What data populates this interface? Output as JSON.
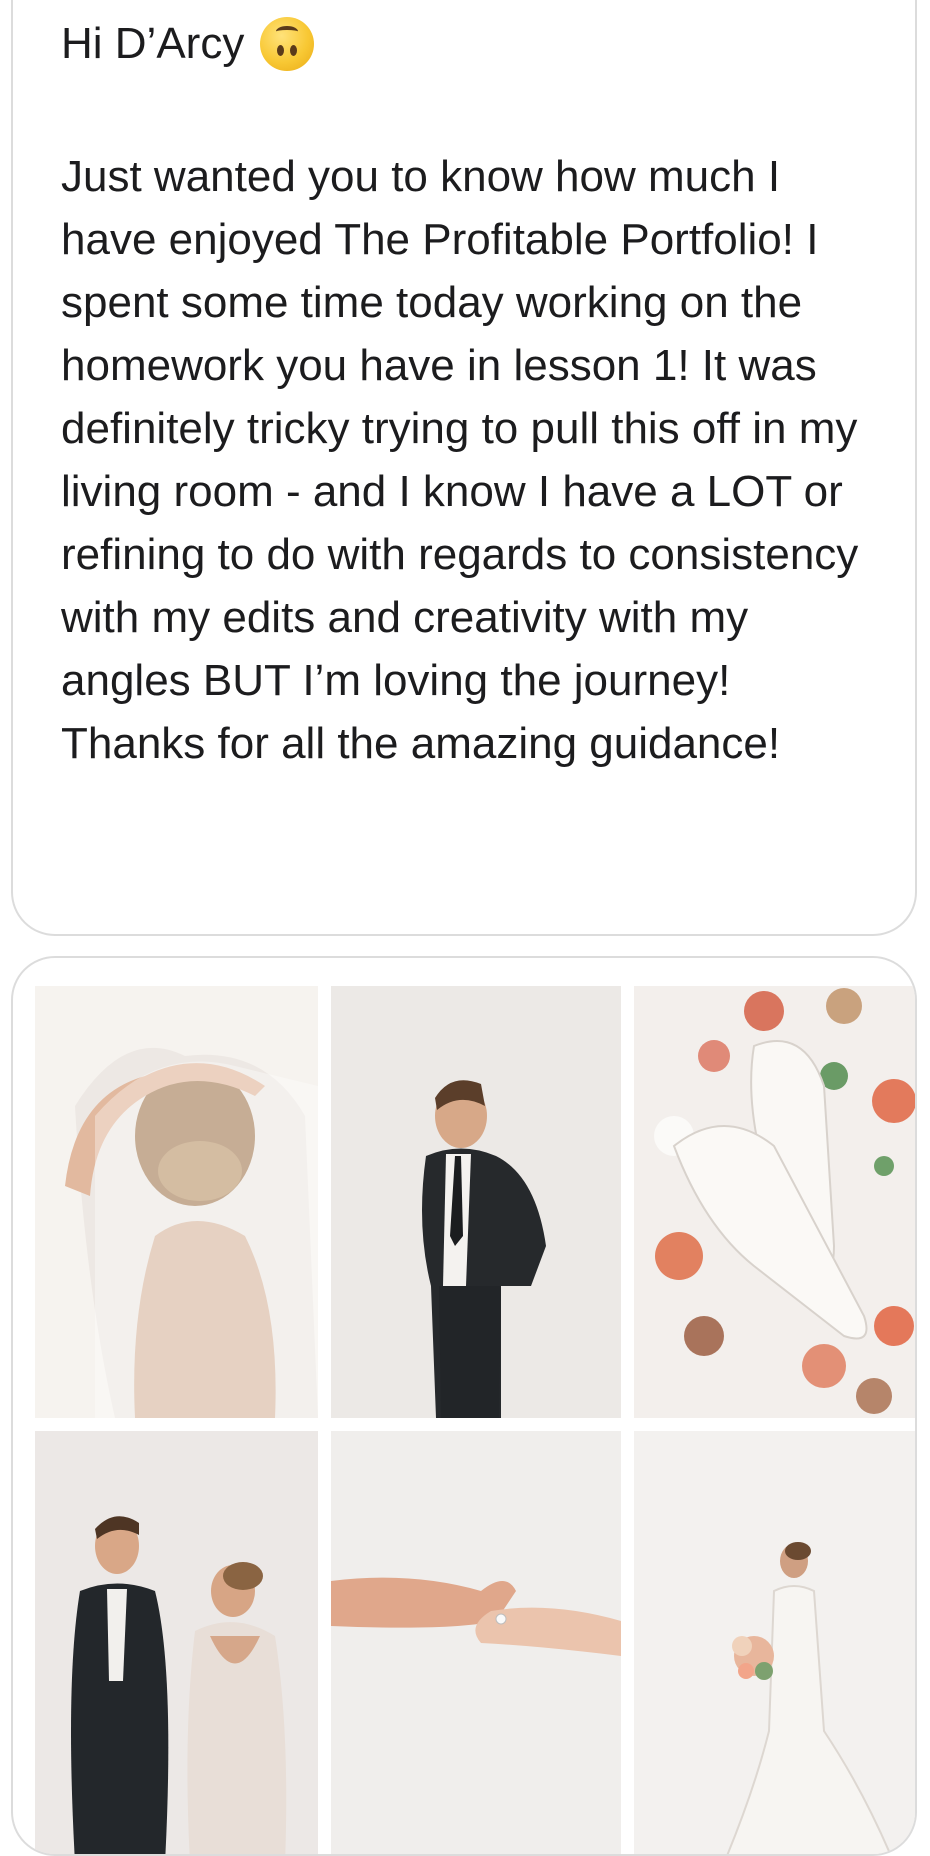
{
  "message": {
    "greeting": "Hi D’Arcy",
    "greeting_emoji": "upside-down-face-emoji",
    "body": "Just wanted you to know how much I have enjoyed The Profitable Portfolio! I spent some time today working on the homework you have in lesson 1! It was definitely tricky trying to pull this off in my living room - and I know I have a LOT or refining to do with regards to consistency with my edits and creativity with my angles BUT I’m loving the journey! Thanks for all the amazing guidance!"
  },
  "photos": [
    {
      "subject": "bride-veil-back-photo"
    },
    {
      "subject": "groom-profile-photo"
    },
    {
      "subject": "bridal-shoes-flatlay-photo"
    },
    {
      "subject": "couple-first-look-photo"
    },
    {
      "subject": "holding-hands-photo"
    },
    {
      "subject": "bride-with-bouquet-photo"
    }
  ],
  "colors": {
    "bubble_border": "#dcdcdc",
    "text": "#1c1c1e",
    "photo_background": "#eeebe8"
  }
}
